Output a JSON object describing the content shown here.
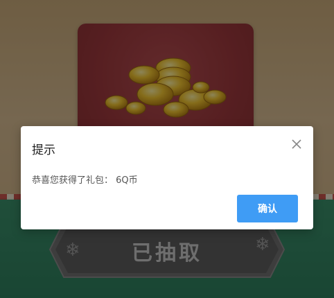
{
  "badge": {
    "label": "已抽取"
  },
  "dialog": {
    "title": "提示",
    "message": "恭喜您获得了礼包： 6Q币",
    "confirm_label": "确认"
  },
  "colors": {
    "primary": "#3f9cf5",
    "card_red": "#9e393d",
    "green": "#2f7f5e"
  }
}
